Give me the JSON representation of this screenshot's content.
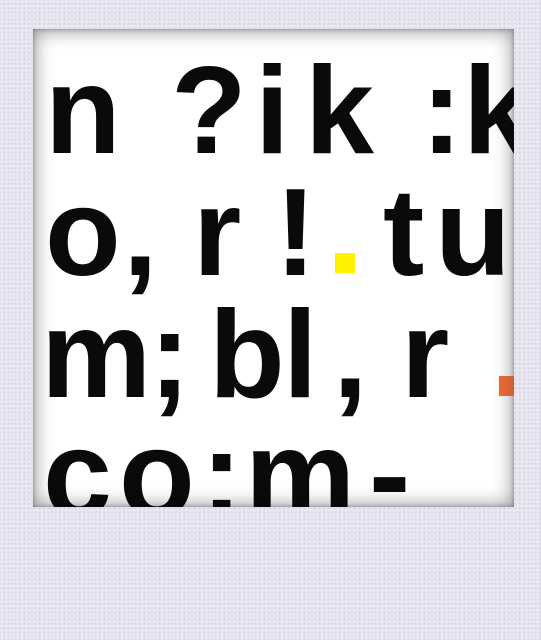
{
  "photo": {
    "lines": [
      {
        "chars": [
          "n",
          "?",
          "i",
          "k",
          ":",
          "k"
        ]
      },
      {
        "chars": [
          "o",
          ",",
          "r",
          "!",
          "",
          "t",
          "u"
        ]
      },
      {
        "chars": [
          "m",
          ";",
          "b",
          "l",
          ",",
          "r",
          ""
        ]
      },
      {
        "chars": [
          "c",
          "o",
          ":",
          "m",
          "-"
        ]
      }
    ],
    "dots": [
      {
        "name": "yellow-dot",
        "color": "#fff200"
      },
      {
        "name": "orange-dot",
        "color": "#e86a3a"
      }
    ]
  },
  "colors": {
    "frame": "#e5e2ef",
    "photo_background": "#ffffff",
    "text": "#0a0a0a"
  }
}
